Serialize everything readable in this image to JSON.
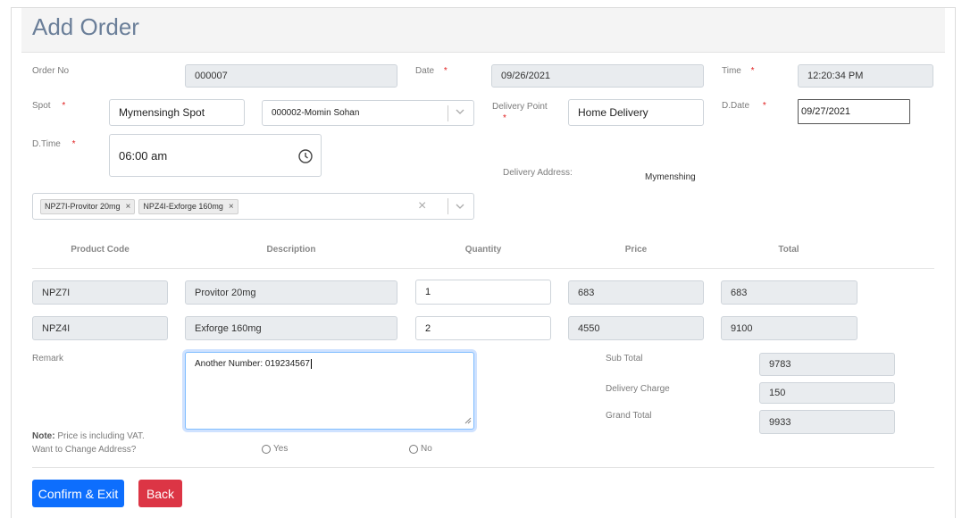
{
  "page_title": "Add Order",
  "order_no": {
    "label": "Order No",
    "value": "000007"
  },
  "date": {
    "label": "Date",
    "value": "09/26/2021",
    "required_mark": "*"
  },
  "time": {
    "label": "Time",
    "value": "12:20:34 PM",
    "required_mark": "*"
  },
  "spot": {
    "label": "Spot",
    "value": "Mymensingh Spot",
    "required_mark": "*"
  },
  "customer_select": {
    "value": "000002-Momin Sohan"
  },
  "delivery_point": {
    "label": "Delivery Point",
    "value": "Home Delivery",
    "required_mark": "*"
  },
  "d_date": {
    "label": "D.Date",
    "value": "09/27/2021",
    "required_mark": "*"
  },
  "d_time": {
    "label": "D.Time",
    "value": "06:00 am",
    "required_mark": "*"
  },
  "delivery_address": {
    "label": "Delivery Address:",
    "value": "Mymenshing"
  },
  "product_tags": [
    {
      "label": "NPZ7I-Provitor 20mg",
      "remove": "×"
    },
    {
      "label": "NPZ4I-Exforge 160mg",
      "remove": "×"
    }
  ],
  "multiselect_clear": "×",
  "table": {
    "headers": [
      "Product Code",
      "Description",
      "Quantity",
      "Price",
      "Total"
    ],
    "rows": [
      {
        "code": "NPZ7I",
        "description": "Provitor 20mg",
        "quantity": "1",
        "price": "683",
        "total": "683"
      },
      {
        "code": "NPZ4I",
        "description": "Exforge 160mg",
        "quantity": "2",
        "price": "4550",
        "total": "9100"
      }
    ]
  },
  "remark": {
    "label": "Remark",
    "value": "Another Number: 019234567"
  },
  "summary": {
    "sub_total_label": "Sub Total",
    "sub_total": "9783",
    "delivery_charge_label": "Delivery Charge",
    "delivery_charge": "150",
    "grand_total_label": "Grand Total",
    "grand_total": "9933"
  },
  "note": {
    "bold": "Note:",
    "text": " Price is including VAT."
  },
  "change_address": {
    "label": "Want to Change Address?",
    "yes": "Yes",
    "no": "No"
  },
  "buttons": {
    "confirm": "Confirm & Exit",
    "back": "Back"
  },
  "colors": {
    "primary": "#0d6efd",
    "danger": "#dc3545",
    "title": "#6b7f99"
  }
}
